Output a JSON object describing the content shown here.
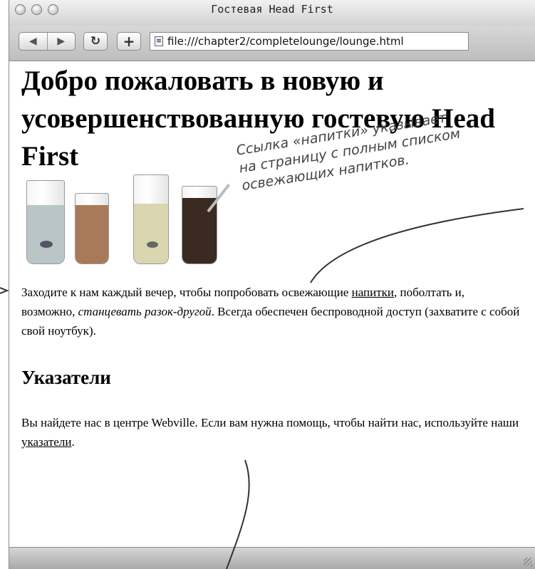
{
  "window": {
    "title": "Гостевая Head First"
  },
  "toolbar": {
    "back_icon": "back-arrow-icon",
    "forward_icon": "forward-arrow-icon",
    "reload_icon": "reload-icon",
    "add_icon": "plus-icon",
    "url": "file:///chapter2/completelounge/lounge.html"
  },
  "page": {
    "heading": "Добро пожаловать в новую и усовершенствованную гостевую Head First",
    "paragraph1": {
      "before": "Заходите к нам каждый вечер, чтобы попробовать освежающие ",
      "link": "напитки",
      "middle": ", поболтать и, возможно, ",
      "emphasis": "станцевать разок-другой",
      "after": ". Всегда обеспечен беспроводной доступ (захватите с собой свой ноутбук)."
    },
    "subheading": "Указатели",
    "paragraph2": {
      "before": "Вы найдете нас в центре Webville. Если вам нужна помощь, чтобы найти нас, используйте наши ",
      "link": "указатели",
      "after": "."
    }
  },
  "annotation": {
    "line1": "Ссылка «напитки» указывает",
    "line2": "на страницу с полным списком",
    "line3": "освежающих напитков."
  },
  "colors": {
    "drink1": "#b8c4c4",
    "drink2": "#a97a5a",
    "drink3": "#d9d6b0",
    "drink4": "#3a2a22"
  }
}
